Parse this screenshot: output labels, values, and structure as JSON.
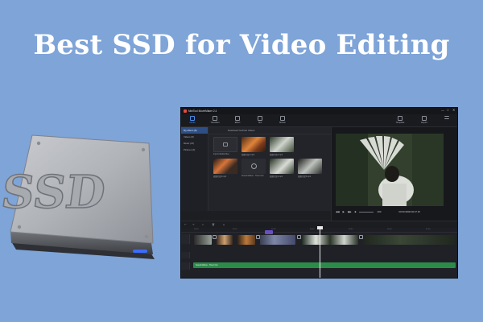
{
  "headline": "Best SSD for Video Editing",
  "ssd": {
    "label": "SSD",
    "led_color": "#3b6cff"
  },
  "app": {
    "title": "MiniTool MovieMaker 2.4",
    "window_controls": [
      "—",
      "□",
      "✕"
    ],
    "toolbar": [
      {
        "label": "Media",
        "icon": "media-icon",
        "active": true
      },
      {
        "label": "Transition",
        "icon": "transition-icon"
      },
      {
        "label": "Effect",
        "icon": "effect-icon"
      },
      {
        "label": "Text",
        "icon": "text-icon"
      },
      {
        "label": "Motion",
        "icon": "motion-icon"
      },
      {
        "label": "Template",
        "icon": "template-icon"
      },
      {
        "label": "Export",
        "icon": "export-icon"
      }
    ],
    "sidebar": [
      {
        "label": "My Album (8)",
        "active": true
      },
      {
        "label": "Videos (8)"
      },
      {
        "label": "Music (15)"
      },
      {
        "label": "Pictures (0)"
      }
    ],
    "library_head": {
      "import": "Import Media Files",
      "download": "Download YouTube Videos"
    },
    "tiles": [
      {
        "caption": "Import Media Files",
        "kind": "import"
      },
      {
        "caption": "视频片段1.mp4",
        "kind": "video"
      },
      {
        "caption": "视频片段2.mp4",
        "kind": "video"
      },
      {
        "caption": "视频片段3.mp4",
        "kind": "video"
      },
      {
        "caption": "Sound Motion - Timer Out",
        "kind": "audio"
      },
      {
        "caption": "视频片段4.mp4",
        "kind": "video"
      },
      {
        "caption": "视频片段5.mp4",
        "kind": "video"
      }
    ],
    "preview": {
      "time": "00:00:40/00:02:47.15",
      "controls": [
        "◀◀",
        "▶",
        "▶▶",
        "■"
      ],
      "zoom": "100"
    },
    "timeline_toolbar": [
      "↶",
      "↷",
      "✂",
      "🗑",
      "A"
    ],
    "ruler": [
      "00:00",
      "00:10",
      "00:20",
      "00:30",
      "00:40",
      "00:50",
      "01:00"
    ],
    "audio_label": "Sound Motion - Timer Out"
  }
}
